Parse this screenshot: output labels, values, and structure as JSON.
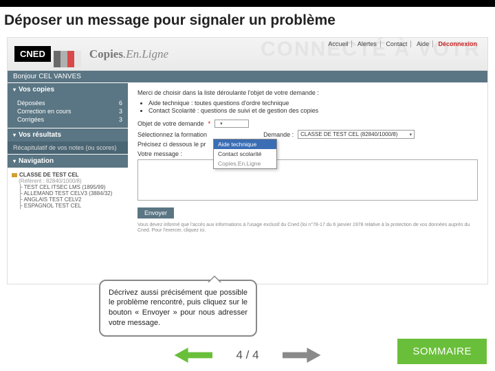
{
  "page": {
    "title": "Déposer un message pour signaler un problème"
  },
  "brand": {
    "cned": "CNED",
    "product1": "Copies",
    "product2": "En.Ligne"
  },
  "watermark": "CONNECTÉ À VOTR",
  "topnav": {
    "accueil": "Accueil",
    "alertes": "Alertes",
    "contact": "Contact",
    "aide": "Aide",
    "deconnexion": "Déconnexion"
  },
  "greet": "Bonjour CEL VANVES",
  "sidebar": {
    "copies": {
      "head": "Vos copies",
      "items": [
        {
          "label": "Déposées",
          "count": "6"
        },
        {
          "label": "Correction en cours",
          "count": "3"
        },
        {
          "label": "Corrigées",
          "count": "3"
        }
      ]
    },
    "resultats": {
      "head": "Vos résultats",
      "sub": "Récapitulatif de vos notes (ou scores)"
    },
    "nav": {
      "head": "Navigation",
      "root": "CLASSE DE TEST CEL",
      "ref": "(Référent : 82840/1000/8)",
      "leaves": [
        "TEST CEL ITSEC LMS (1895/99)",
        "ALLEMAND TEST CELV3 (3884/32)",
        "ANGLAIS TEST CELV2",
        "ESPAGNOL TEST CEL"
      ]
    }
  },
  "main": {
    "intro": "Merci de choisir dans la liste déroulante l'objet de votre demande :",
    "bullets": [
      "Aide technique : toutes questions d'ordre technique",
      "Contact Scolarité : questions de suivi et de gestion des copies"
    ],
    "objet": "Objet de votre demande",
    "selectFormation": "Sélectionnez la formation",
    "formationVal": "CLASSE DE TEST CEL (82840/1000/8)",
    "demande": "Demande :",
    "precisez": "Précisez ci dessous le pr",
    "msg": "Votre message :",
    "dropdown": {
      "opt1": "Aide technique",
      "opt2": "Contact scolarité",
      "opt3": "Copies.En.Ligne"
    },
    "send": "Envoyer",
    "disclaimer": "Vous devez informé que l'accès aux informations à l'usage exclusif du Cned (loi n°78-17 du 6 janvier 1978 relative à la protection de vos données auprès du Cned. Pour l'exercer, cliquez ici."
  },
  "callout": "Décrivez aussi précisément que possible le problème rencontré, puis cliquez sur le bouton « Envoyer » pour nous adresser votre message.",
  "footer": {
    "page": "4 / 4",
    "sommaire": "SOMMAIRE"
  }
}
